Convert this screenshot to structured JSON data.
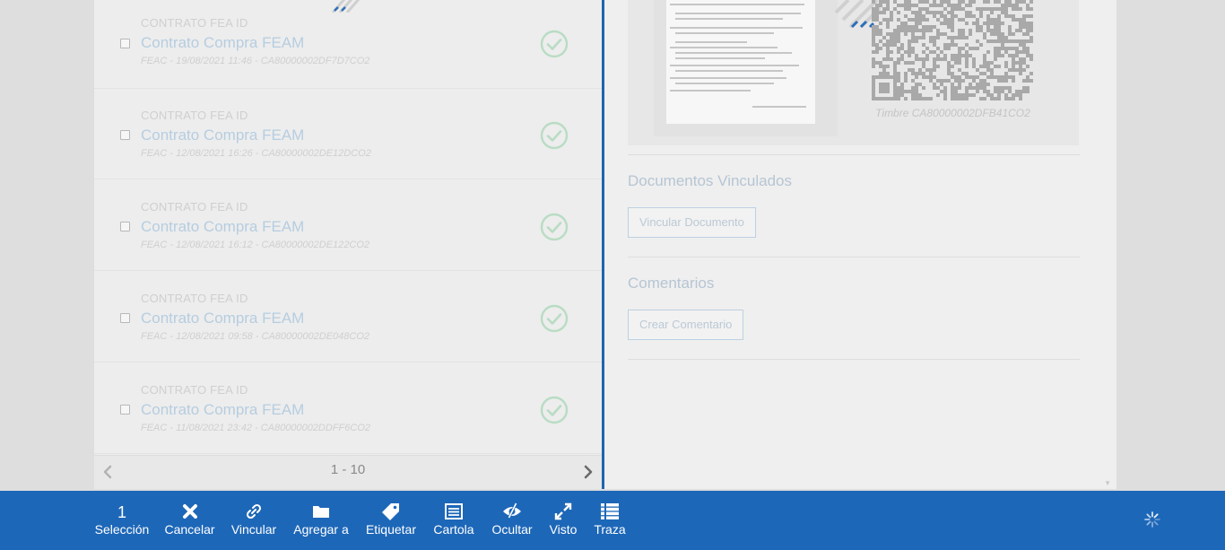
{
  "documents": [
    {
      "kind": "CONTRATO FEA ID",
      "title": "Contrato Compra FEAM",
      "meta": "FEAC - 19/08/2021 11:46 - CA80000002DF7D7CO2"
    },
    {
      "kind": "CONTRATO FEA ID",
      "title": "Contrato Compra FEAM",
      "meta": "FEAC - 12/08/2021 16:26 - CA80000002DE12DCO2"
    },
    {
      "kind": "CONTRATO FEA ID",
      "title": "Contrato Compra FEAM",
      "meta": "FEAC - 12/08/2021 16:12 - CA80000002DE122CO2"
    },
    {
      "kind": "CONTRATO FEA ID",
      "title": "Contrato Compra FEAM",
      "meta": "FEAC - 12/08/2021 09:58 - CA80000002DE048CO2"
    },
    {
      "kind": "CONTRATO FEA ID",
      "title": "Contrato Compra FEAM",
      "meta": "FEAC - 11/08/2021 23:42 - CA80000002DDFF6CO2"
    }
  ],
  "pager": {
    "range": "1 - 10"
  },
  "detail": {
    "timbre": "Timbre CA80000002DFB41CO2",
    "linked_docs_title": "Documentos Vinculados",
    "link_doc_button": "Vincular Documento",
    "comments_title": "Comentarios",
    "create_comment_button": "Crear Comentario"
  },
  "toolbar": {
    "selection_count": "1",
    "selection_label": "Selección",
    "cancel": "Cancelar",
    "link": "Vincular",
    "add_to": "Agregar a",
    "tag": "Etiquetar",
    "cartola": "Cartola",
    "hide": "Ocultar",
    "seen": "Visto",
    "trace": "Traza"
  },
  "colors": {
    "toolbar_bg": "#1d67b8",
    "divider": "#1f64ad",
    "ok_check": "#b9dcc4",
    "title_text": "#b6cde0"
  },
  "icons": [
    "checkbox-icon",
    "check-circle-icon",
    "chevron-left-icon",
    "chevron-right-icon",
    "qr-code-icon",
    "close-icon",
    "link-icon",
    "folder-icon",
    "tag-icon",
    "list-alt-icon",
    "eye-slash-icon",
    "expand-icon",
    "list-icon",
    "spinner-icon"
  ]
}
